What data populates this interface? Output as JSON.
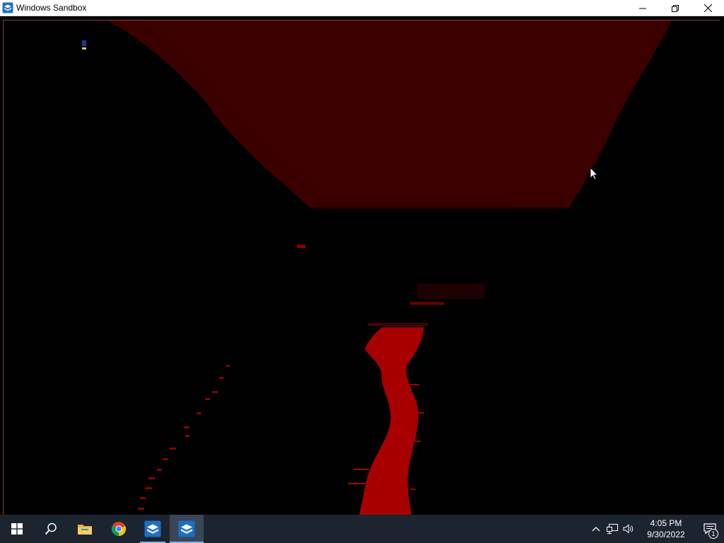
{
  "window": {
    "title": "Windows Sandbox",
    "icon": "sandbox-icon",
    "controls": [
      "minimize-icon",
      "restore-icon",
      "close-icon"
    ]
  },
  "content": {
    "description_icon": "mouse-pointer-icon"
  },
  "taskbar": {
    "apps": [
      {
        "name": "start-button",
        "icon": "windows-logo-icon"
      },
      {
        "name": "search-button",
        "icon": "search-icon"
      },
      {
        "name": "file-explorer",
        "icon": "folder-icon"
      },
      {
        "name": "google-chrome",
        "icon": "chrome-icon"
      },
      {
        "name": "windows-sandbox",
        "icon": "sandbox-icon",
        "state": "running"
      },
      {
        "name": "windows-sandbox-active",
        "icon": "sandbox-icon",
        "state": "active"
      }
    ],
    "tray": {
      "time": "4:05 PM",
      "date": "9/30/2022",
      "notification_count": "1",
      "icons": [
        "chevron-up-icon",
        "network-icon",
        "volume-icon"
      ]
    }
  },
  "colors": {
    "sky": "#3a0000",
    "river": "#a80000",
    "taskbar": "#1c2430",
    "accent": "#7fb3e6"
  }
}
